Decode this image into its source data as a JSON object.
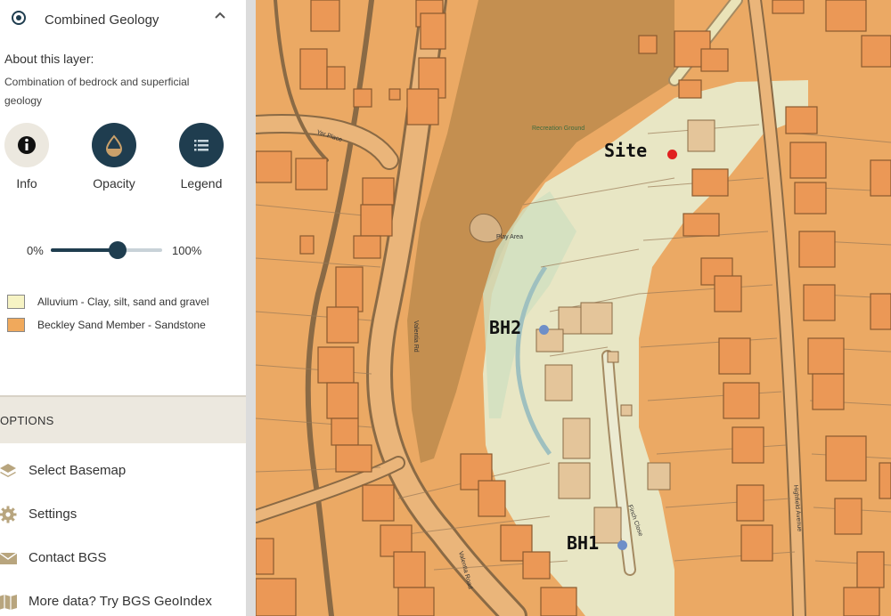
{
  "layer": {
    "title": "Combined Geology",
    "about_title": "About this layer:",
    "about_text": "Combination of bedrock and superficial geology"
  },
  "buttons": {
    "info": "Info",
    "opacity": "Opacity",
    "legend": "Legend"
  },
  "slider": {
    "min_label": "0%",
    "max_label": "100%",
    "value_fraction": 0.6
  },
  "legend": [
    {
      "label": "Alluvium - Clay, silt, sand and gravel",
      "color": "#f6f3c4"
    },
    {
      "label": "Beckley Sand Member - Sandstone",
      "color": "#f0a95c"
    }
  ],
  "options": {
    "header": "OPTIONS",
    "items": [
      {
        "label": "Select Basemap",
        "icon": "layers-icon"
      },
      {
        "label": "Settings",
        "icon": "gear-icon"
      },
      {
        "label": "Contact BGS",
        "icon": "envelope-icon"
      },
      {
        "label": "More data? Try BGS GeoIndex",
        "icon": "map-icon"
      }
    ]
  },
  "map": {
    "markers": [
      {
        "label": "Site",
        "color": "#e02020"
      },
      {
        "label": "BH2",
        "color": "#6e8fc8"
      },
      {
        "label": "BH1",
        "color": "#6e8fc8"
      }
    ],
    "place_labels": {
      "recreation": "Recreation Ground",
      "play_area": "Play Area",
      "road1": "Valentia Rd",
      "road2": "Valentia Road",
      "road3": "Finch Close",
      "road4": "Highfield Avenue",
      "road5": "Yer Place"
    }
  },
  "colors": {
    "accent": "#1f3d4f",
    "alluvium": "#f6f3c4",
    "sandstone": "#f0a95c"
  }
}
